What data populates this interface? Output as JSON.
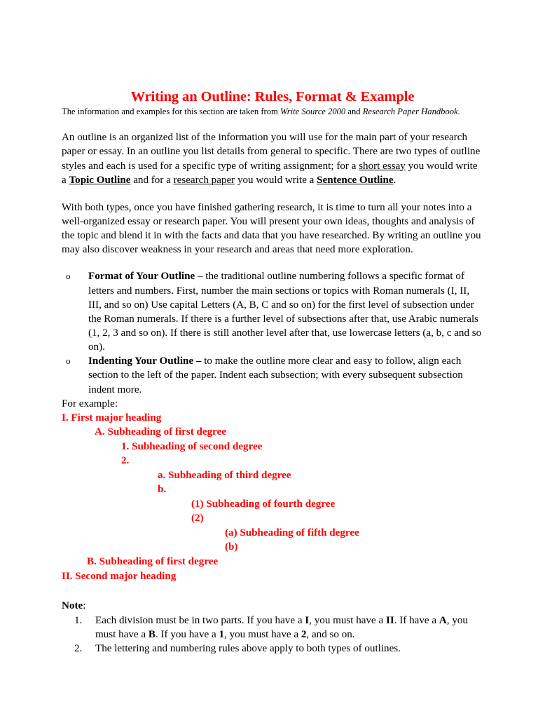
{
  "document": {
    "title": "Writing an Outline: Rules, Format & Example",
    "title_color": "#ff0000",
    "subtitle": {
      "prefix": "The information and examples for this section are taken from ",
      "source_1": "Write Source 2000",
      "conjunction": " and ",
      "source_2": "Research Paper Handbook",
      "suffix": "."
    },
    "paragraphs": [
      {
        "segments": [
          {
            "text": "An outline is an organized list of the information you will use for the main part of your research paper or essay. In an outline you list details from general to specific.  There are two types of outline styles and each is used for a specific type of writing assignment; for a ",
            "style": "plain"
          },
          {
            "text": "short essay",
            "style": "underline"
          },
          {
            "text": " you would write a ",
            "style": "plain"
          },
          {
            "text": "Topic Outline",
            "style": "bold-underline"
          },
          {
            "text": " and for a ",
            "style": "plain"
          },
          {
            "text": "research paper",
            "style": "underline"
          },
          {
            "text": " you would write a ",
            "style": "plain"
          },
          {
            "text": "Sentence Outline",
            "style": "bold-underline"
          },
          {
            "text": ".",
            "style": "plain"
          }
        ]
      },
      {
        "segments": [
          {
            "text": "With both types, once you have finished gathering research, it is time to turn all your notes into a well-organized essay or research paper.  You will present your own ideas, thoughts and analysis of the topic and blend it in with the facts and data that you have researched. By writing an outline you may also discover weakness in your research and areas that need more exploration.",
            "style": "plain"
          }
        ]
      }
    ],
    "bullets": [
      {
        "marker": "o",
        "lead": "Format of Your Outline",
        "body": " – the traditional outline numbering follows a specific format of letters and numbers.  First, number the main sections or topics with Roman numerals (I, II, III, and so on) Use capital Letters (A, B, C and so on) for the first level of subsection under the Roman numerals.  If there is a further level of subsections after that, use Arabic numerals (1, 2, 3 and so on).  If there is still another level after that, use lowercase letters (a, b, c and so on)."
      },
      {
        "marker": "o",
        "lead": "Indenting Your Outline –",
        "body": " to make the outline more clear and easy to follow, align each section to the left of the paper.  Indent each subsection; with every subsequent subsection indent more."
      }
    ],
    "for_example_label": "For example:",
    "sample_outline": [
      {
        "text": "I.  First major heading",
        "level": 1
      },
      {
        "text": "A.  Subheading of first degree",
        "level": 2
      },
      {
        "text": "1. Subheading of second degree",
        "level": 3
      },
      {
        "text": "2.",
        "level": 3
      },
      {
        "text": "a. Subheading of third degree",
        "level": 4
      },
      {
        "text": "b.",
        "level": 4
      },
      {
        "text": "(1) Subheading of fourth degree",
        "level": 5
      },
      {
        "text": "(2)",
        "level": 5
      },
      {
        "text": "(a) Subheading of fifth degree",
        "level": 6
      },
      {
        "text": "(b)",
        "level": 6
      },
      {
        "text": "B. Subheading of first degree",
        "level": "2b"
      },
      {
        "text": "II.  Second major heading",
        "level": 1
      }
    ],
    "note": {
      "heading_bold": "Note",
      "heading_rest": ":",
      "items": [
        {
          "number": "1.",
          "segments": [
            {
              "text": "Each division must be in two parts.  If you have a ",
              "style": "plain"
            },
            {
              "text": "I",
              "style": "bold"
            },
            {
              "text": ", you must have a ",
              "style": "plain"
            },
            {
              "text": "II",
              "style": "bold"
            },
            {
              "text": ".  If have a ",
              "style": "plain"
            },
            {
              "text": "A",
              "style": "bold"
            },
            {
              "text": ", you must have a ",
              "style": "plain"
            },
            {
              "text": "B",
              "style": "bold"
            },
            {
              "text": ".  If you have a ",
              "style": "plain"
            },
            {
              "text": "1",
              "style": "bold"
            },
            {
              "text": ", you must have a ",
              "style": "plain"
            },
            {
              "text": "2",
              "style": "bold"
            },
            {
              "text": ", and so on.",
              "style": "plain"
            }
          ]
        },
        {
          "number": "2.",
          "segments": [
            {
              "text": "The lettering and numbering rules above apply to both types of outlines.",
              "style": "plain"
            }
          ]
        }
      ]
    }
  }
}
